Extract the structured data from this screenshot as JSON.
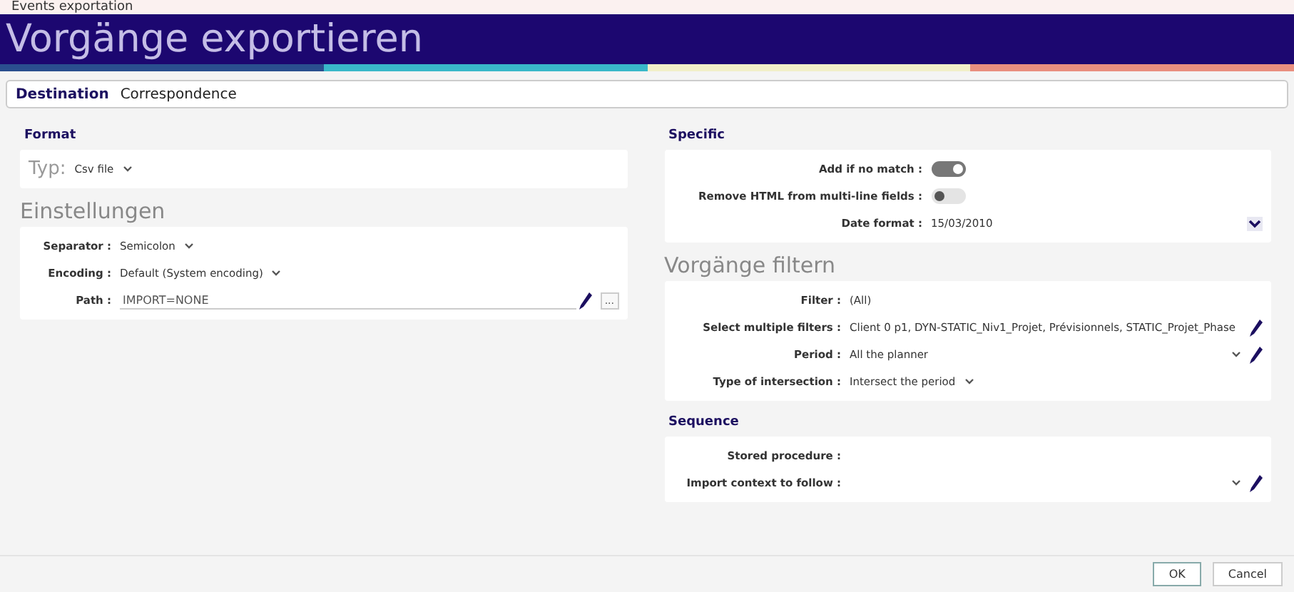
{
  "window": {
    "title": "Events exportation"
  },
  "header": {
    "title": "Vorgänge exportieren"
  },
  "destination": {
    "label": "Destination",
    "value": "Correspondence"
  },
  "format": {
    "heading": "Format",
    "type_label": "Typ:",
    "type_value": "Csv file"
  },
  "settings": {
    "heading": "Einstellungen",
    "fields": [
      {
        "kind": "select",
        "label": "Separator :",
        "value": "Semicolon"
      },
      {
        "kind": "select",
        "label": "Encoding :",
        "value": "Default (System encoding)"
      },
      {
        "kind": "path",
        "label": "Path :",
        "value": "IMPORT=NONE",
        "browse": "..."
      }
    ]
  },
  "specific": {
    "heading": "Specific",
    "fields": [
      {
        "kind": "toggle",
        "label": "Add if no match :",
        "on": true
      },
      {
        "kind": "toggle",
        "label": "Remove HTML from multi-line fields :",
        "on": false
      },
      {
        "kind": "date",
        "label": "Date format :",
        "value": "15/03/2010"
      }
    ]
  },
  "filters": {
    "heading": "Vorgänge filtern",
    "fields": [
      {
        "kind": "text",
        "label": "Filter :",
        "value": "(All)"
      },
      {
        "kind": "edit",
        "label": "Select multiple filters :",
        "value": "Client 0 p1, DYN-STATIC_Niv1_Projet, Prévisionnels, STATIC_Projet_Phase"
      },
      {
        "kind": "select-edit",
        "label": "Period :",
        "value": "All the planner"
      },
      {
        "kind": "select",
        "label": "Type of intersection :",
        "value": "Intersect the period"
      }
    ]
  },
  "sequence": {
    "heading": "Sequence",
    "fields": [
      {
        "kind": "text",
        "label": "Stored procedure :"
      },
      {
        "kind": "select-edit",
        "label": "Import context to follow :"
      }
    ]
  },
  "buttons": [
    "OK",
    "Cancel"
  ]
}
